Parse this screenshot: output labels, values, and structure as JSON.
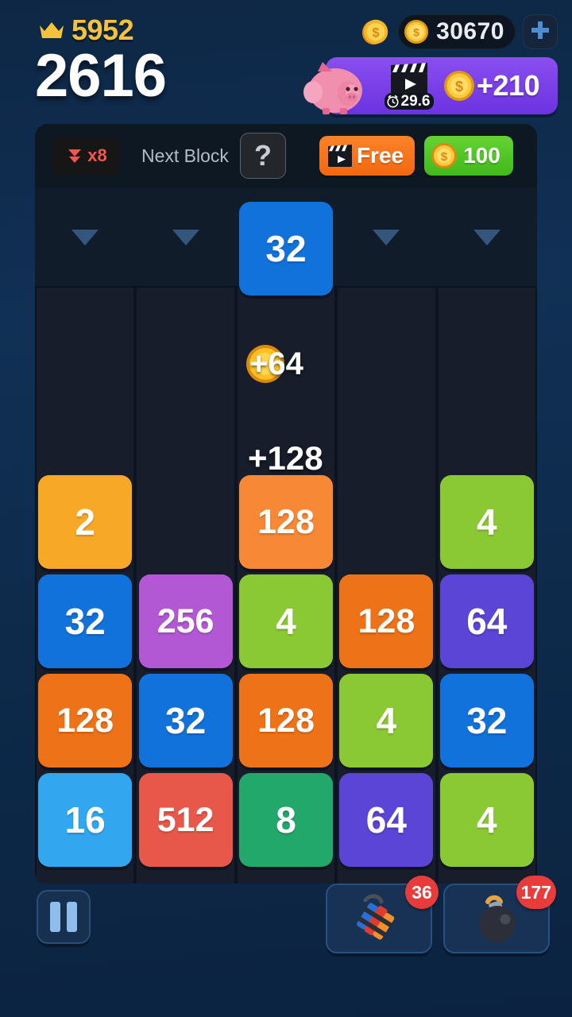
{
  "header": {
    "crown_icon": "crown-icon",
    "crown_value": "5952",
    "score": "2616",
    "coin_icon": "coin-icon",
    "coin_amount": "30670",
    "plus_icon": "plus-icon",
    "piggy": {
      "piggy_icon": "piggy-bank-icon",
      "video_icon": "clapperboard-play-icon",
      "timer_icon": "alarm-clock-icon",
      "timer_value": "29.6",
      "reward_coin_icon": "coin-icon",
      "reward_text": "+210",
      "background_color": "#7a41ea"
    }
  },
  "toolbar": {
    "multiplier_icon": "double-chevron-down-icon",
    "multiplier_label": "x8",
    "next_block_label": "Next Block",
    "next_block_value": "?",
    "free_icon": "clapperboard-play-icon",
    "free_label": "Free",
    "buy_coin_icon": "coin-icon",
    "buy_label": "100",
    "free_color": "#F26811",
    "buy_color": "#41B81C"
  },
  "board": {
    "columns": 5,
    "drop_arrow_icon": "chevron-down-triangle-icon",
    "drop_arrows_visible": [
      true,
      true,
      false,
      true,
      true
    ],
    "falling_tile": {
      "value": "32",
      "color": "#1272DC",
      "column": 2
    },
    "popups": [
      {
        "type": "coin",
        "icon": "coin-icon",
        "text": "+64",
        "column": 2
      },
      {
        "type": "plain",
        "text": "+128",
        "column": 2
      }
    ],
    "grid_rows": [
      [
        {
          "value": "2",
          "color": "#F7A827"
        },
        null,
        {
          "value": "128",
          "color": "#F78835"
        },
        null,
        {
          "value": "4",
          "color": "#8BC934"
        }
      ],
      [
        {
          "value": "32",
          "color": "#1272DC"
        },
        {
          "value": "256",
          "color": "#B358D4"
        },
        {
          "value": "4",
          "color": "#8BC934"
        },
        {
          "value": "128",
          "color": "#EE7218"
        },
        {
          "value": "64",
          "color": "#5B45D6"
        }
      ],
      [
        {
          "value": "128",
          "color": "#EE7218"
        },
        {
          "value": "32",
          "color": "#1272DC"
        },
        {
          "value": "128",
          "color": "#EE7218"
        },
        {
          "value": "4",
          "color": "#8BC934"
        },
        {
          "value": "32",
          "color": "#1272DC"
        }
      ],
      [
        {
          "value": "16",
          "color": "#32A7F0"
        },
        {
          "value": "512",
          "color": "#E8584A"
        },
        {
          "value": "8",
          "color": "#22A86B"
        },
        {
          "value": "64",
          "color": "#5B45D6"
        },
        {
          "value": "4",
          "color": "#8BC934"
        }
      ]
    ]
  },
  "bottom": {
    "pause_icon": "pause-icon",
    "powerups": [
      {
        "icon": "dynamite-icon",
        "count": "36"
      },
      {
        "icon": "bomb-icon",
        "count": "177"
      }
    ]
  }
}
